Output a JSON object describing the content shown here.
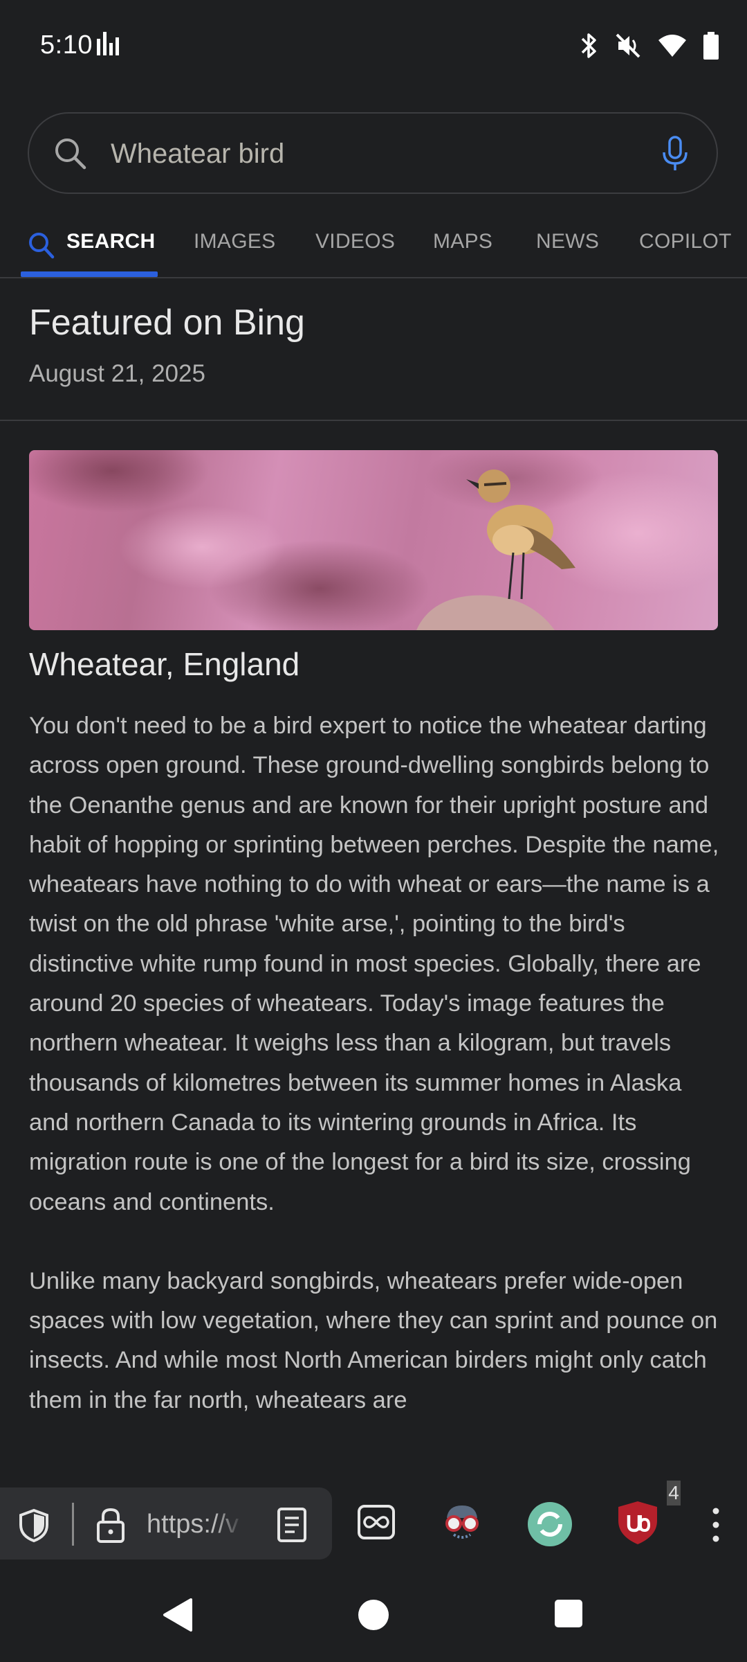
{
  "status_bar": {
    "time": "5:10",
    "colors": {
      "icon": "#ffffff"
    }
  },
  "search": {
    "query": "Wheatear bird",
    "accent": "#4a8cf2"
  },
  "tabs": [
    {
      "label": "SEARCH",
      "active": true
    },
    {
      "label": "IMAGES",
      "active": false
    },
    {
      "label": "VIDEOS",
      "active": false
    },
    {
      "label": "MAPS",
      "active": false
    },
    {
      "label": "NEWS",
      "active": false
    },
    {
      "label": "COPILOT",
      "active": false
    }
  ],
  "header": {
    "title": "Featured on Bing",
    "date": "August 21, 2025"
  },
  "article": {
    "title": "Wheatear, England",
    "paragraphs": [
      "You don't need to be a bird expert to notice the wheatear darting across open ground. These ground-dwelling songbirds belong to the Oenanthe genus and are known for their upright posture and habit of hopping or sprinting between perches. Despite the name, wheatears have nothing to do with wheat or ears—the name is a twist on the old phrase 'white arse,', pointing to the bird's distinctive white rump found in most species. Globally, there are around 20 species of wheatears. Today's image features the northern wheatear. It weighs less than a kilogram, but travels thousands of kilometres between its summer homes in Alaska and northern Canada to its wintering grounds in Africa. Its migration route is one of the longest for a bird its size, crossing oceans and continents.",
      "Unlike many backyard songbirds, wheatears prefer wide-open spaces with low vegetation, where they can sprint and pounce on insects. And while most North American birders might only catch them in the far north, wheatears are"
    ]
  },
  "browser": {
    "url": "https://v",
    "ublock_badge": "4",
    "colors": {
      "ublock_red": "#b5202b",
      "extension_teal": "#6fbfa6"
    }
  }
}
